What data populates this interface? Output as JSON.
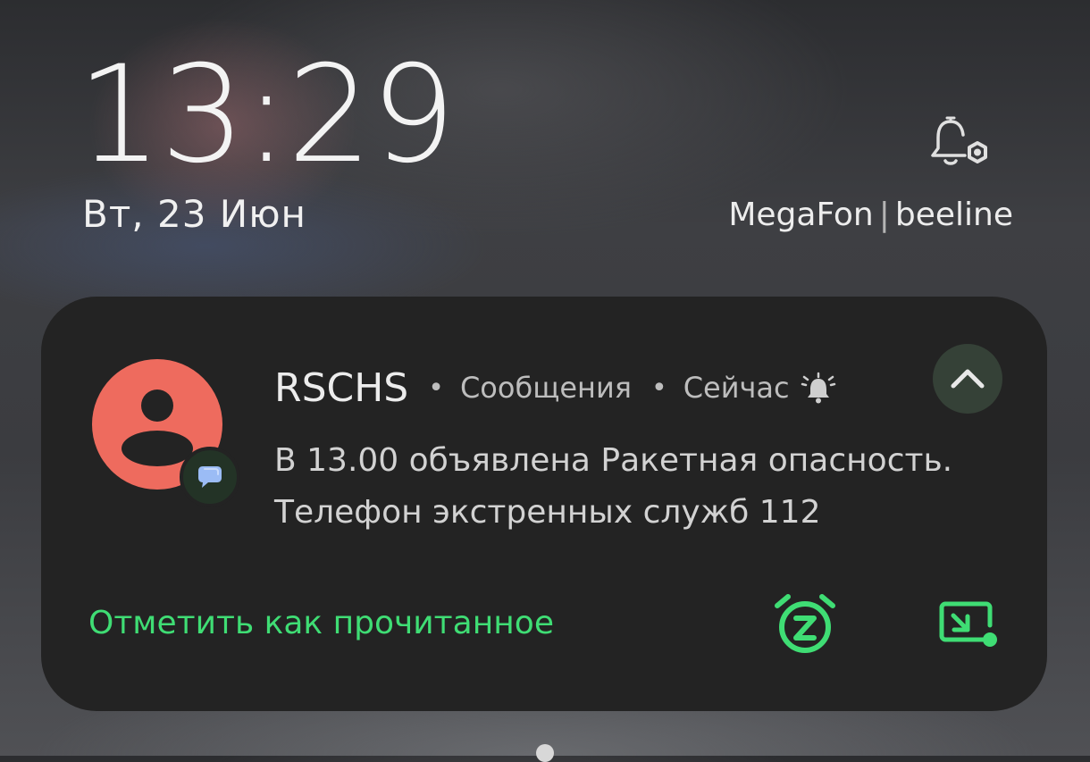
{
  "lockscreen": {
    "time": "13:29",
    "date": "Вт, 23 Июн",
    "carriers": [
      "MegaFon",
      "beeline"
    ],
    "carrier_separator": "|"
  },
  "notification": {
    "sender": "RSCHS",
    "app": "Сообщения",
    "when": "Сейчас",
    "separator": "•",
    "message_lines": [
      "В 13.00 объявлена Ракетная опасность.",
      "Телефон экстренных служб 112"
    ],
    "mark_read_label": "Отметить как прочитанное",
    "icons": {
      "alarm": "alarm-bell-icon",
      "collapse": "chevron-up-icon",
      "snooze": "snooze-alarm-clock-icon",
      "expand": "picture-in-picture-icon",
      "app_badge": "messages-bubble-icon",
      "avatar": "person-icon"
    },
    "colors": {
      "accent": "#3fdd74",
      "avatar_bg": "#ee6b5e",
      "card_bg": "#232323"
    }
  }
}
